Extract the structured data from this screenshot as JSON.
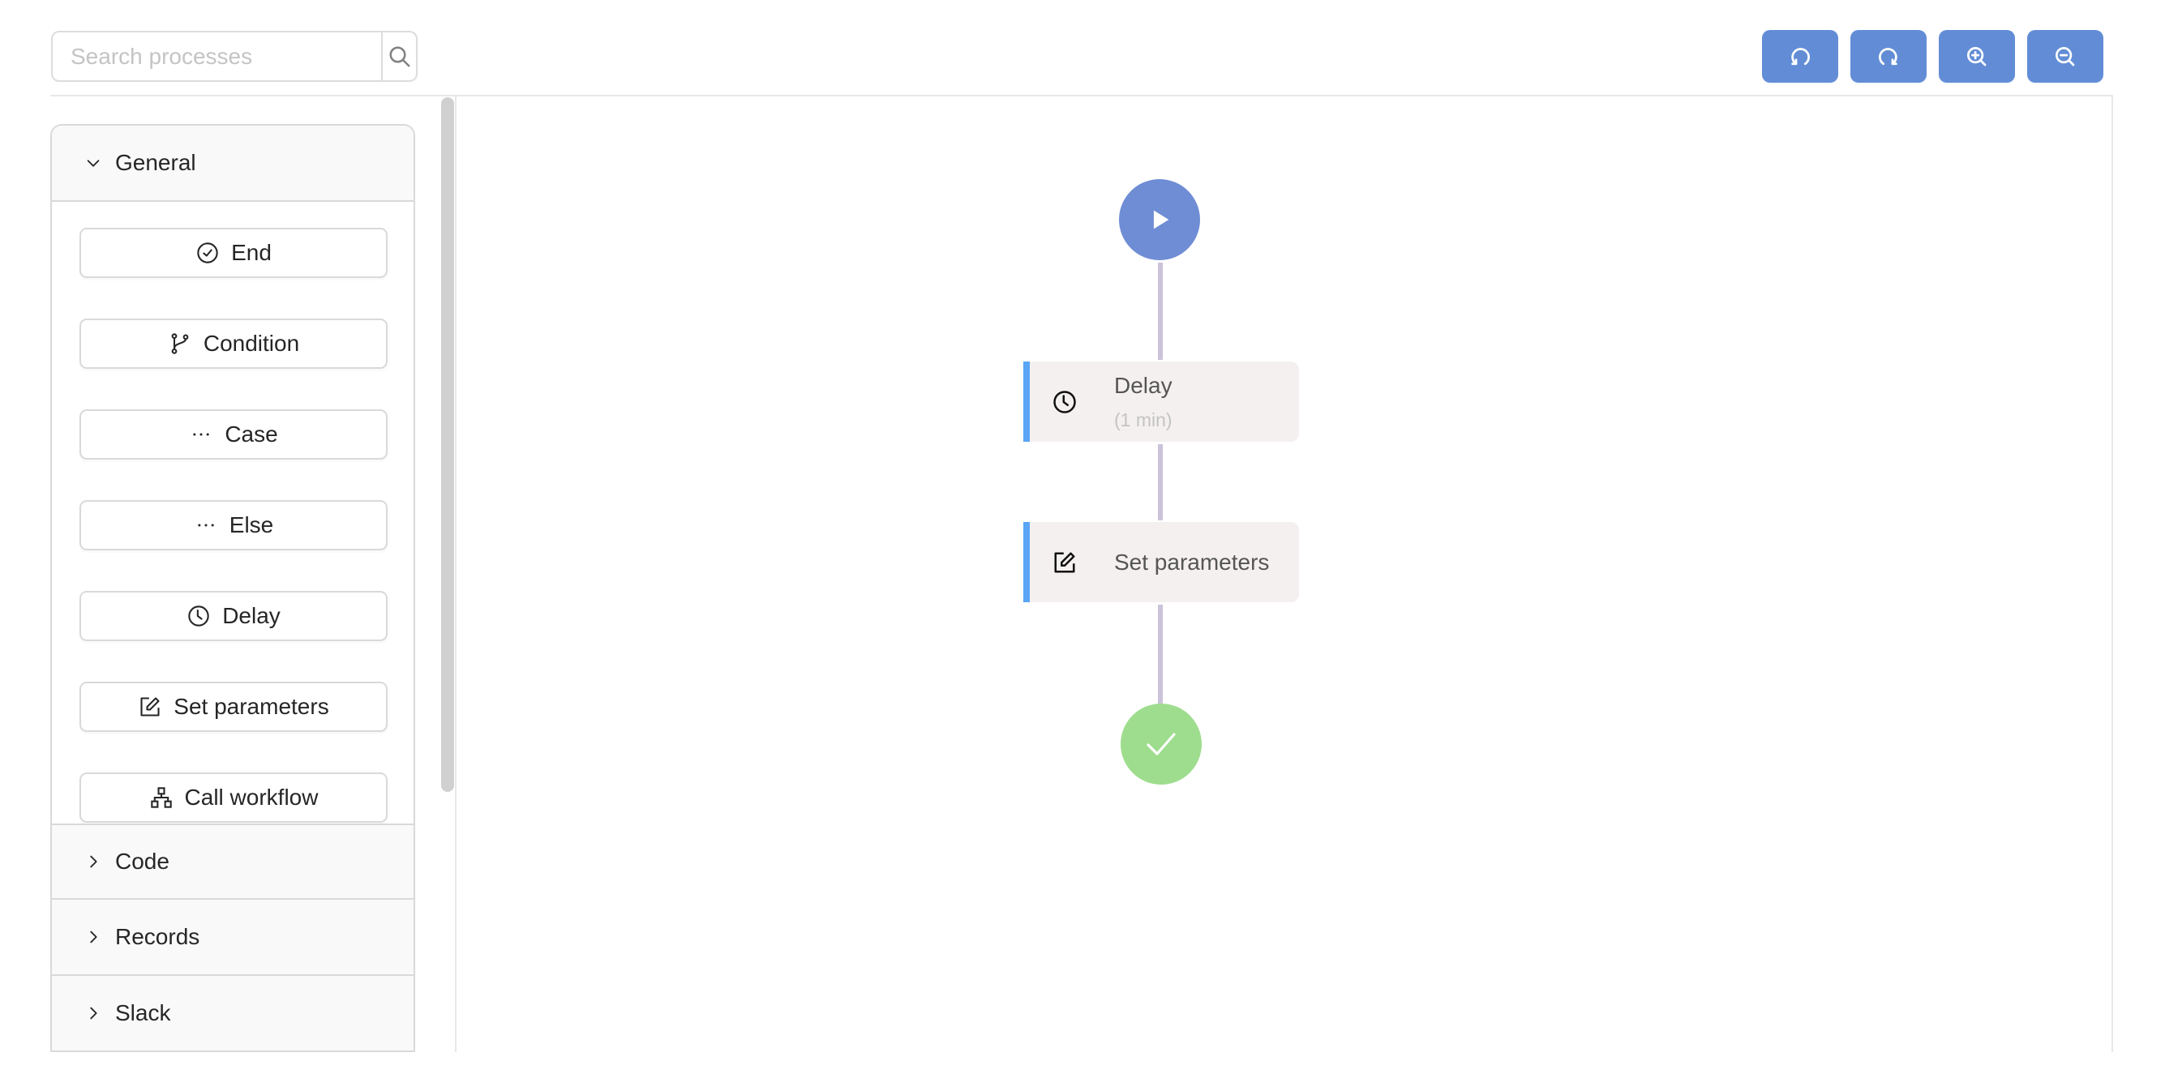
{
  "search": {
    "placeholder": "Search processes",
    "value": "",
    "icon": "search-icon"
  },
  "toolbar": {
    "accent_color": "#628dd6",
    "buttons": [
      {
        "name": "undo",
        "icon": "rotate-ccw-icon"
      },
      {
        "name": "redo",
        "icon": "rotate-cw-icon"
      },
      {
        "name": "zoom-in",
        "icon": "zoom-in-icon"
      },
      {
        "name": "zoom-out",
        "icon": "zoom-out-icon"
      }
    ]
  },
  "sidebar": {
    "sections": [
      {
        "label": "General",
        "expanded": true,
        "items": [
          {
            "label": "End",
            "icon": "check-circle-icon"
          },
          {
            "label": "Condition",
            "icon": "git-branch-icon"
          },
          {
            "label": "Case",
            "icon": "ellipsis-icon"
          },
          {
            "label": "Else",
            "icon": "ellipsis-icon"
          },
          {
            "label": "Delay",
            "icon": "clock-icon"
          },
          {
            "label": "Set parameters",
            "icon": "edit-icon"
          },
          {
            "label": "Call workflow",
            "icon": "sitemap-icon"
          }
        ]
      },
      {
        "label": "Code",
        "expanded": false
      },
      {
        "label": "Records",
        "expanded": false
      },
      {
        "label": "Slack",
        "expanded": false
      }
    ]
  },
  "flow": {
    "colors": {
      "start": "#6f8dd5",
      "end": "#9edd8e",
      "node_bg": "#f5f0f0",
      "node_accent": "#5aa5f5",
      "connector": "#cbc3d9"
    },
    "start": {
      "icon": "play-icon"
    },
    "nodes": [
      {
        "title": "Delay",
        "subtitle": "(1 min)",
        "icon": "clock-icon"
      },
      {
        "title": "Set parameters",
        "icon": "edit-icon"
      }
    ],
    "end": {
      "icon": "check-icon"
    }
  }
}
